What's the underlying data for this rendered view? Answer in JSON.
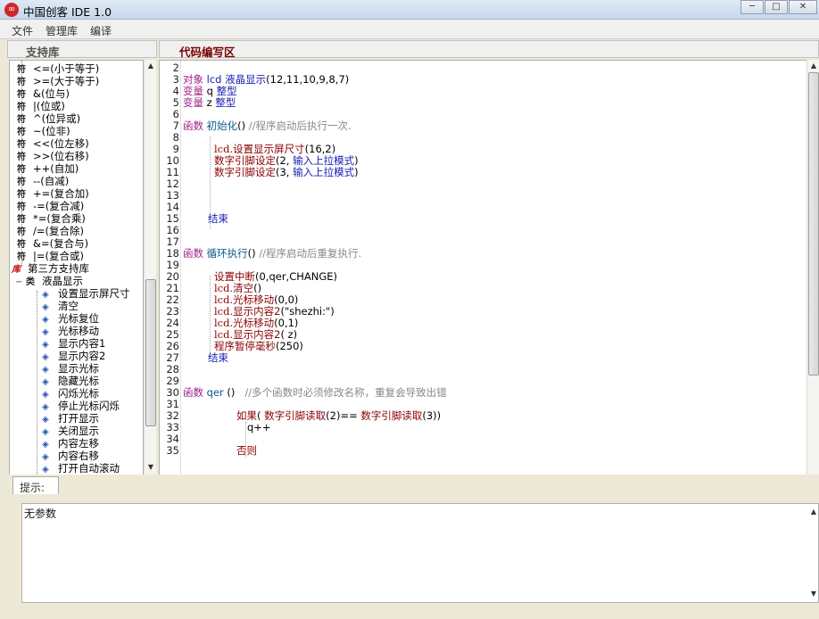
{
  "window": {
    "title": "中国创客 IDE   1.0",
    "logo": "∞",
    "min_glyph": "─",
    "max_glyph": "□",
    "close_glyph": "✕"
  },
  "menu": [
    "文件",
    "管理库",
    "编译"
  ],
  "library_panel": {
    "header": "支持库",
    "items": [
      {
        "icon": "符",
        "label": "<=(小于等于)",
        "kind": "op"
      },
      {
        "icon": "符",
        "label": ">=(大于等于)",
        "kind": "op"
      },
      {
        "icon": "符",
        "label": "&(位与)",
        "kind": "op"
      },
      {
        "icon": "符",
        "label": "|(位或)",
        "kind": "op"
      },
      {
        "icon": "符",
        "label": "^(位异或)",
        "kind": "op"
      },
      {
        "icon": "符",
        "label": "~(位非)",
        "kind": "op"
      },
      {
        "icon": "符",
        "label": "<<(位左移)",
        "kind": "op"
      },
      {
        "icon": "符",
        "label": ">>(位右移)",
        "kind": "op"
      },
      {
        "icon": "符",
        "label": "++(自加)",
        "kind": "op"
      },
      {
        "icon": "符",
        "label": "--(自减)",
        "kind": "op"
      },
      {
        "icon": "符",
        "label": "+=(复合加)",
        "kind": "op"
      },
      {
        "icon": "符",
        "label": "-=(复合减)",
        "kind": "op"
      },
      {
        "icon": "符",
        "label": "*=(复合乘)",
        "kind": "op"
      },
      {
        "icon": "符",
        "label": "/=(复合除)",
        "kind": "op"
      },
      {
        "icon": "符",
        "label": "&=(复合与)",
        "kind": "op"
      },
      {
        "icon": "符",
        "label": "|=(复合或)",
        "kind": "op"
      },
      {
        "icon": "库",
        "label": "第三方支持库",
        "kind": "lib"
      },
      {
        "icon": "类",
        "label": "液晶显示",
        "kind": "class",
        "expander": "−"
      },
      {
        "icon": "◈",
        "label": "设置显示屏尺寸",
        "kind": "method"
      },
      {
        "icon": "◈",
        "label": "清空",
        "kind": "method"
      },
      {
        "icon": "◈",
        "label": "光标复位",
        "kind": "method"
      },
      {
        "icon": "◈",
        "label": "光标移动",
        "kind": "method"
      },
      {
        "icon": "◈",
        "label": "显示内容1",
        "kind": "method"
      },
      {
        "icon": "◈",
        "label": "显示内容2",
        "kind": "method"
      },
      {
        "icon": "◈",
        "label": "显示光标",
        "kind": "method"
      },
      {
        "icon": "◈",
        "label": "隐藏光标",
        "kind": "method"
      },
      {
        "icon": "◈",
        "label": "闪烁光标",
        "kind": "method"
      },
      {
        "icon": "◈",
        "label": "停止光标闪烁",
        "kind": "method"
      },
      {
        "icon": "◈",
        "label": "打开显示",
        "kind": "method"
      },
      {
        "icon": "◈",
        "label": "关闭显示",
        "kind": "method"
      },
      {
        "icon": "◈",
        "label": "内容左移",
        "kind": "method"
      },
      {
        "icon": "◈",
        "label": "内容右移",
        "kind": "method"
      },
      {
        "icon": "◈",
        "label": "打开自动滚动",
        "kind": "method"
      }
    ]
  },
  "editor": {
    "header": "代码编写区",
    "lines": [
      {
        "n": "2",
        "indent": 0,
        "parts": []
      },
      {
        "n": "3",
        "indent": 0,
        "parts": [
          [
            "kw",
            "对象 "
          ],
          [
            "blue",
            "lcd "
          ],
          [
            "blue",
            "液晶显示"
          ],
          [
            "plain",
            "(12,11,10,9,8,7)"
          ]
        ]
      },
      {
        "n": "4",
        "indent": 0,
        "parts": [
          [
            "kw",
            "变量 "
          ],
          [
            "plain",
            "q "
          ],
          [
            "blue",
            "整型"
          ]
        ]
      },
      {
        "n": "5",
        "indent": 0,
        "parts": [
          [
            "kw",
            "变量 "
          ],
          [
            "plain",
            "z "
          ],
          [
            "blue",
            "整型"
          ]
        ]
      },
      {
        "n": "6",
        "indent": 0,
        "parts": []
      },
      {
        "n": "7",
        "indent": 0,
        "parts": [
          [
            "kw",
            "函数 "
          ],
          [
            "fn",
            "初始化"
          ],
          [
            "plain",
            "() "
          ],
          [
            "grey",
            "//程序启动后执行一次."
          ]
        ]
      },
      {
        "n": "8",
        "indent": 0,
        "parts": []
      },
      {
        "n": "9",
        "indent": 35,
        "parts": [
          [
            "lcd",
            "lcd."
          ],
          [
            "red",
            "设置显示屏尺寸"
          ],
          [
            "plain",
            "(16,2)"
          ]
        ]
      },
      {
        "n": "10",
        "indent": 35,
        "parts": [
          [
            "red",
            "数字引脚设定"
          ],
          [
            "plain",
            "(2, "
          ],
          [
            "blue",
            "输入上拉模式"
          ],
          [
            "plain",
            ")"
          ]
        ]
      },
      {
        "n": "11",
        "indent": 35,
        "parts": [
          [
            "red",
            "数字引脚设定"
          ],
          [
            "plain",
            "(3, "
          ],
          [
            "blue",
            "输入上拉模式"
          ],
          [
            "plain",
            ")"
          ]
        ]
      },
      {
        "n": "12",
        "indent": 0,
        "parts": []
      },
      {
        "n": "13",
        "indent": 0,
        "parts": []
      },
      {
        "n": "14",
        "indent": 0,
        "parts": []
      },
      {
        "n": "15",
        "indent": 28,
        "parts": [
          [
            "blue",
            "结束"
          ]
        ]
      },
      {
        "n": "16",
        "indent": 0,
        "parts": []
      },
      {
        "n": "17",
        "indent": 0,
        "parts": []
      },
      {
        "n": "18",
        "indent": 0,
        "parts": [
          [
            "kw",
            "函数 "
          ],
          [
            "fn",
            "循环执行"
          ],
          [
            "plain",
            "() "
          ],
          [
            "grey",
            "//程序启动后重复执行."
          ]
        ]
      },
      {
        "n": "19",
        "indent": 0,
        "parts": []
      },
      {
        "n": "20",
        "indent": 35,
        "parts": [
          [
            "red",
            "设置中断"
          ],
          [
            "plain",
            "(0,qer,CHANGE)"
          ]
        ]
      },
      {
        "n": "21",
        "indent": 35,
        "parts": [
          [
            "lcd",
            "lcd."
          ],
          [
            "red",
            "清空"
          ],
          [
            "plain",
            "()"
          ]
        ]
      },
      {
        "n": "22",
        "indent": 35,
        "parts": [
          [
            "lcd",
            "lcd."
          ],
          [
            "red",
            "光标移动"
          ],
          [
            "plain",
            "(0,0)"
          ]
        ]
      },
      {
        "n": "23",
        "indent": 35,
        "parts": [
          [
            "lcd",
            "lcd."
          ],
          [
            "red",
            "显示内容2"
          ],
          [
            "plain",
            "(\"shezhi:\")"
          ]
        ]
      },
      {
        "n": "24",
        "indent": 35,
        "parts": [
          [
            "lcd",
            "lcd."
          ],
          [
            "red",
            "光标移动"
          ],
          [
            "plain",
            "(0,1)"
          ]
        ]
      },
      {
        "n": "25",
        "indent": 35,
        "parts": [
          [
            "lcd",
            "lcd."
          ],
          [
            "red",
            "显示内容2"
          ],
          [
            "plain",
            "( z)"
          ]
        ]
      },
      {
        "n": "26",
        "indent": 35,
        "parts": [
          [
            "red",
            "程序暂停毫秒"
          ],
          [
            "plain",
            "(250)"
          ]
        ]
      },
      {
        "n": "27",
        "indent": 28,
        "parts": [
          [
            "blue",
            "结束"
          ]
        ]
      },
      {
        "n": "28",
        "indent": 0,
        "parts": []
      },
      {
        "n": "29",
        "indent": 0,
        "parts": []
      },
      {
        "n": "30",
        "indent": 0,
        "parts": [
          [
            "kw",
            "函数 "
          ],
          [
            "fn",
            "qer "
          ],
          [
            "plain",
            "() "
          ],
          [
            "grey",
            "  //多个函数时必须修改名称，重复会导致出错"
          ]
        ]
      },
      {
        "n": "31",
        "indent": 0,
        "parts": []
      },
      {
        "n": "32",
        "indent": 60,
        "parts": [
          [
            "red",
            "如果"
          ],
          [
            "plain",
            "( "
          ],
          [
            "red",
            "数字引脚读取"
          ],
          [
            "plain",
            "(2)== "
          ],
          [
            "red",
            "数字引脚读取"
          ],
          [
            "plain",
            "(3))"
          ]
        ]
      },
      {
        "n": "33",
        "indent": 72,
        "parts": [
          [
            "plain",
            "q++"
          ]
        ]
      },
      {
        "n": "34",
        "indent": 0,
        "parts": []
      },
      {
        "n": "35",
        "indent": 60,
        "parts": [
          [
            "red",
            "否则"
          ]
        ]
      }
    ]
  },
  "hint_panel": {
    "tab": "提示:",
    "text": "无参数"
  }
}
